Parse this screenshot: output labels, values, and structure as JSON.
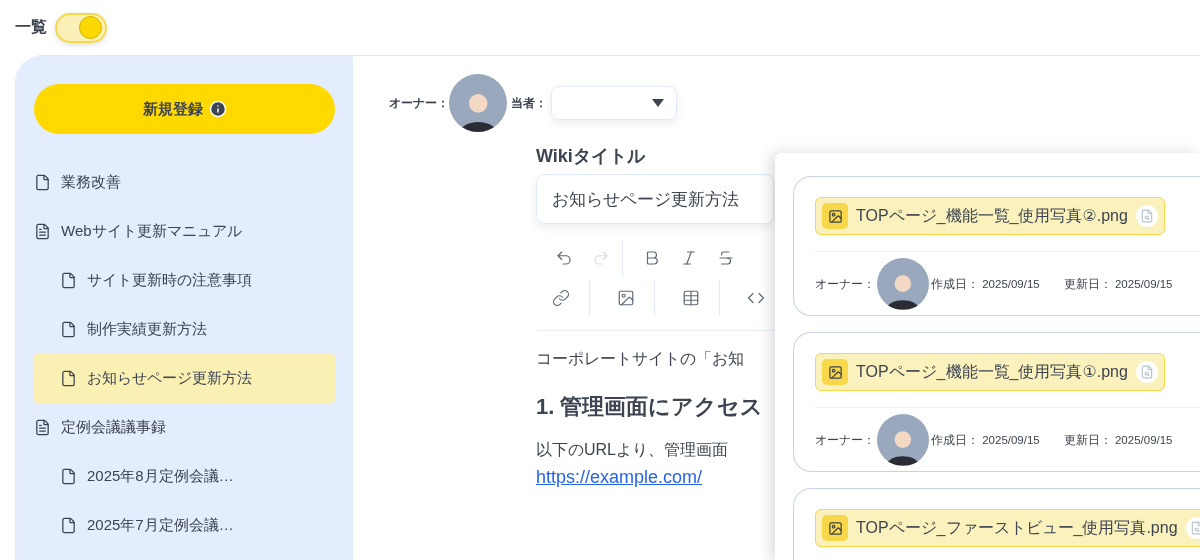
{
  "view_toggle": {
    "label": "一覧",
    "on": true
  },
  "sidebar": {
    "new_button": "新規登録",
    "items": [
      {
        "label": "業務改善",
        "selected": false
      },
      {
        "label": "Webサイト更新マニュアル",
        "selected": false,
        "children": [
          {
            "label": "サイト更新時の注意事項",
            "selected": false
          },
          {
            "label": "制作実績更新方法",
            "selected": false
          },
          {
            "label": "お知らせページ更新方法",
            "selected": true
          }
        ]
      },
      {
        "label": "定例会議議事録",
        "selected": false,
        "children": [
          {
            "label": "2025年8月定例会議…",
            "selected": false
          },
          {
            "label": "2025年7月定例会議…",
            "selected": false
          }
        ]
      }
    ]
  },
  "header": {
    "owner_label": "オーナー：",
    "assignee_label": "当者："
  },
  "editor": {
    "title_label": "Wikiタイトル",
    "title_value": "お知らせページ更新方法",
    "toolbar": [
      [
        {
          "kind": "undo",
          "disabled": false
        },
        {
          "kind": "redo",
          "disabled": true
        },
        {
          "kind": "bold",
          "disabled": false
        },
        {
          "kind": "italic",
          "disabled": false
        },
        {
          "kind": "strike",
          "disabled": false
        }
      ],
      [
        {
          "kind": "link",
          "disabled": false
        },
        {
          "kind": "image",
          "disabled": false
        },
        {
          "kind": "table",
          "disabled": false
        },
        {
          "kind": "code",
          "disabled": false
        }
      ]
    ],
    "body": [
      {
        "kind": "paragraph",
        "text": "コーポレートサイトの「お知"
      },
      {
        "kind": "heading",
        "text": "1. 管理画面にアクセス"
      },
      {
        "kind": "paragraph",
        "text": "以下のURLより、管理画面"
      },
      {
        "kind": "link",
        "text": "https://example.com/"
      }
    ]
  },
  "files": [
    {
      "name": "TOPページ_機能一覧_使用写真②.png",
      "owner_label": "オーナー：",
      "created": "作成日： 2025/09/15",
      "updated": "更新日： 2025/09/15"
    },
    {
      "name": "TOPページ_機能一覧_使用写真①.png",
      "owner_label": "オーナー：",
      "created": "作成日： 2025/09/15",
      "updated": "更新日： 2025/09/15"
    },
    {
      "name": "TOPページ_ファーストビュー_使用写真.png"
    }
  ]
}
